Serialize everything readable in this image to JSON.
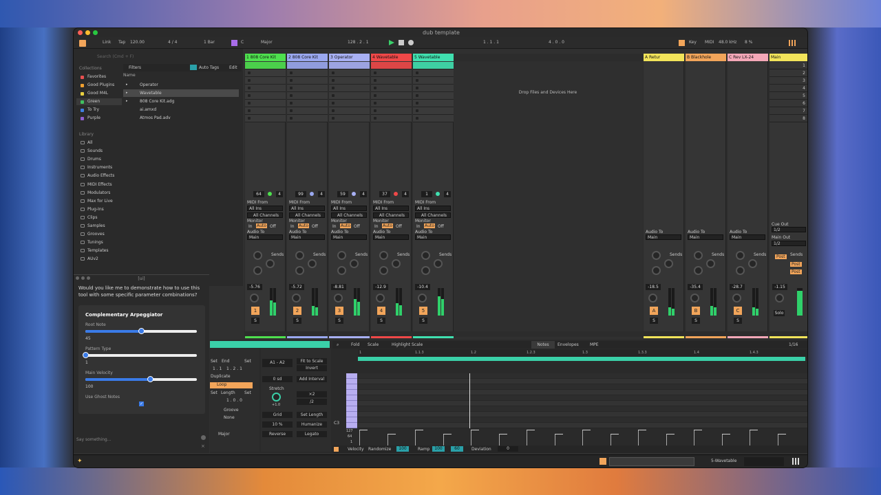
{
  "window": {
    "title": "dub template"
  },
  "control_bar": {
    "link": "Link",
    "tap": "Tap",
    "tempo": "120.00",
    "signature": "4 / 4",
    "quantize": "1 Bar",
    "key": "C",
    "scale": "Major",
    "loop_start": "128 .  2 .  1",
    "position": "1 .  1 .  1",
    "loop_length": "4 .  0 .  0",
    "key_label": "Key",
    "midi_label": "MIDI",
    "sample_rate": "48.0 kHz",
    "cpu": "8 %"
  },
  "browser": {
    "search_placeholder": "Search (Cmd + F)",
    "collections_header": "Collections",
    "filters": "Filters",
    "auto_tags": "Auto Tags",
    "edit": "Edit",
    "name_header": "Name",
    "collections": [
      {
        "label": "Favorites",
        "color": "#e85050"
      },
      {
        "label": "Good Plugins",
        "color": "#f0a030"
      },
      {
        "label": "Good M4L",
        "color": "#e8d040"
      },
      {
        "label": "Green",
        "color": "#40c060"
      },
      {
        "label": "To Try",
        "color": "#4080e0"
      },
      {
        "label": "Purple",
        "color": "#9060d0"
      }
    ],
    "library_header": "Library",
    "library": [
      "All",
      "Sounds",
      "Drums",
      "Instruments",
      "Audio Effects",
      "MIDI Effects",
      "Modulators",
      "Max for Live",
      "Plug-Ins",
      "Clips",
      "Samples",
      "Grooves",
      "Tunings",
      "Templates",
      "AUv2"
    ],
    "files": [
      "Operator",
      "Wavetable",
      "808 Core Kit.adg",
      "ai.amxd",
      "Atmos Pad.adv"
    ]
  },
  "tracks": [
    {
      "name": "1 808 Core Kit",
      "color": "#4ee04e",
      "num": "1",
      "vol": "-5.76",
      "clip": "64",
      "clip2": "4",
      "meter": 0.55
    },
    {
      "name": "2 808 Core Kit",
      "color": "#9aa8f0",
      "num": "2",
      "vol": "-5.72",
      "clip": "99",
      "clip2": "4",
      "meter": 0.35
    },
    {
      "name": "3 Operator",
      "color": "#a8b0f4",
      "num": "3",
      "vol": "-8.81",
      "clip": "59",
      "clip2": "4",
      "meter": 0.6
    },
    {
      "name": "4 Wavetable",
      "color": "#f04848",
      "num": "4",
      "vol": "-12.9",
      "clip": "37",
      "clip2": "4",
      "meter": 0.45
    },
    {
      "name": "5 Wavetable",
      "color": "#40e0b0",
      "num": "5",
      "vol": "-10.4",
      "clip": "1",
      "clip2": "4",
      "meter": 0.7
    }
  ],
  "returns": [
    {
      "name": "A Retur",
      "color": "#f2e45a",
      "num": "A",
      "vol": "-18.5",
      "meter": 0.3
    },
    {
      "name": "B Blackhole",
      "color": "#f2a55a",
      "num": "B",
      "vol": "-35.4",
      "meter": 0.35
    },
    {
      "name": "C Rev LX-24",
      "color": "#f4a8b8",
      "num": "C",
      "vol": "-28.7",
      "meter": 0.3
    }
  ],
  "main": {
    "name": "Main",
    "color": "#f2e45a",
    "vol": "-1.15",
    "cue_out": "Cue Out",
    "cue_val": "1/2",
    "main_out": "Main Out",
    "main_val": "1/2",
    "solo": "Solo",
    "meter": 0.9,
    "scenes": [
      "1",
      "2",
      "3",
      "4",
      "5",
      "6",
      "7",
      "8"
    ]
  },
  "io": {
    "midi_from": "MIDI From",
    "all_ins": "All Ins",
    "all_channels": "All Channels",
    "monitor": "Monitor",
    "in": "In",
    "auto": "Auto",
    "off": "Off",
    "audio_to": "Audio To",
    "main": "Main",
    "sends": "Sends",
    "post": "Post"
  },
  "drop_text": "Drop Files and Devices Here",
  "chat": {
    "header": "[ui]",
    "question": "Would you like me to demonstrate how to use this tool with some specific parameter combinations?",
    "widget_title": "Complementary Arpeggiator",
    "root_note_label": "Root Note",
    "root_note": "45",
    "pattern_label": "Pattern Type",
    "pattern": "1",
    "velocity_label": "Main Velocity",
    "velocity": "100",
    "ghost_label": "Use Ghost Notes",
    "placeholder": "Say something...",
    "sliders": {
      "root": 0.5,
      "pattern": 0.0,
      "velocity": 0.58
    }
  },
  "clip": {
    "set": "Set",
    "end": "End",
    "end_val": "1 .  2 .  1",
    "duplicate": "Duplicate",
    "loop": "Loop",
    "length": "Length",
    "length_val": "1 .  0 .  0",
    "groove": "Groove",
    "groove_val": "None",
    "scale": "Major",
    "start_val": "1 .  1"
  },
  "editor": {
    "range": "A1 - A2",
    "fit": "Fit to Scale",
    "invert": "Invert",
    "zero_sd": "0 sd",
    "add_interval": "Add Interval",
    "stretch": "Stretch",
    "stretch_val": "+1.0",
    "x2": "×2",
    "half": "/2",
    "grid": "Grid",
    "set_length": "Set Length",
    "pct": "10 %",
    "humanize": "Humanize",
    "reverse": "Reverse",
    "legato": "Legato"
  },
  "piano": {
    "fold": "Fold",
    "scale": "Scale",
    "highlight": "Highlight Scale",
    "tabs": [
      "Notes",
      "Envelopes",
      "MPE"
    ],
    "grid": "1/16",
    "ruler": [
      "1",
      "1.1.3",
      "1.2",
      "1.2.3",
      "1.3",
      "1.3.3",
      "1.4",
      "1.4.3"
    ],
    "c3": "C3",
    "vel_ticks": [
      "127",
      "64",
      "1"
    ],
    "velocity": "Velocity",
    "randomize": "Randomize",
    "rand_val": "100",
    "ramp": "Ramp",
    "ramp_a": "100",
    "ramp_b": "60",
    "deviation": "Deviation",
    "dev_val": "0"
  },
  "status": {
    "track": "5-Wavetable"
  }
}
